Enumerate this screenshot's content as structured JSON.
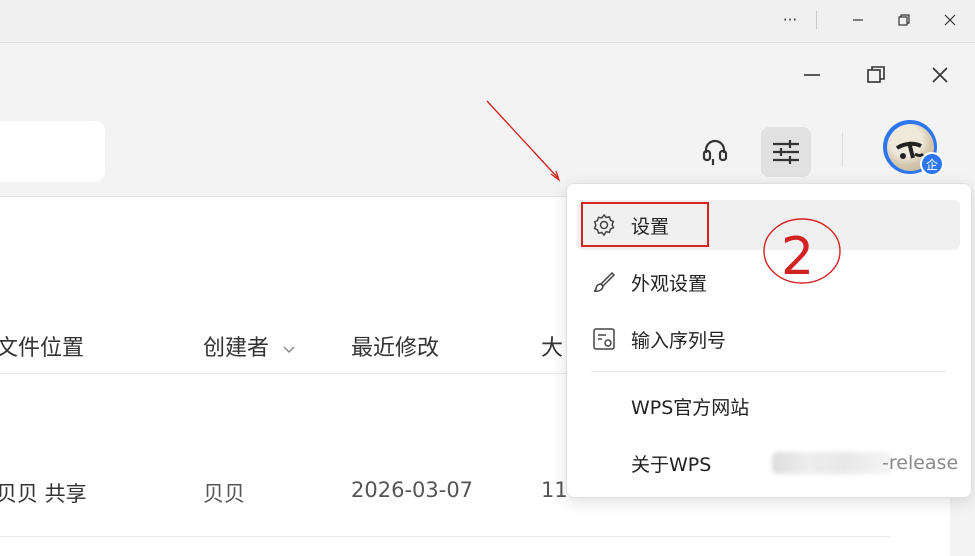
{
  "window": {
    "more_label": "···",
    "minimize_label": "–",
    "restore_label": "⧉",
    "close_label": "✕"
  },
  "table": {
    "headers": {
      "location": "文件位置",
      "creator": "创建者",
      "modified": "最近修改",
      "size": "大"
    },
    "row": {
      "location": "贝贝 共享",
      "creator": "贝贝",
      "modified": "2026-03-07",
      "size": "11"
    }
  },
  "menu": {
    "items": [
      {
        "label": "设置",
        "icon": "gear-icon"
      },
      {
        "label": "外观设置",
        "icon": "brush-icon"
      },
      {
        "label": "输入序列号",
        "icon": "serial-key-icon"
      },
      {
        "label": "WPS官方网站"
      },
      {
        "label": "关于WPS"
      }
    ],
    "version_suffix": "-release"
  },
  "avatar": {
    "badge": "企"
  },
  "annotation": {
    "number": "2"
  },
  "colors": {
    "accent": "#2d76f0",
    "annotation": "#d32222"
  }
}
